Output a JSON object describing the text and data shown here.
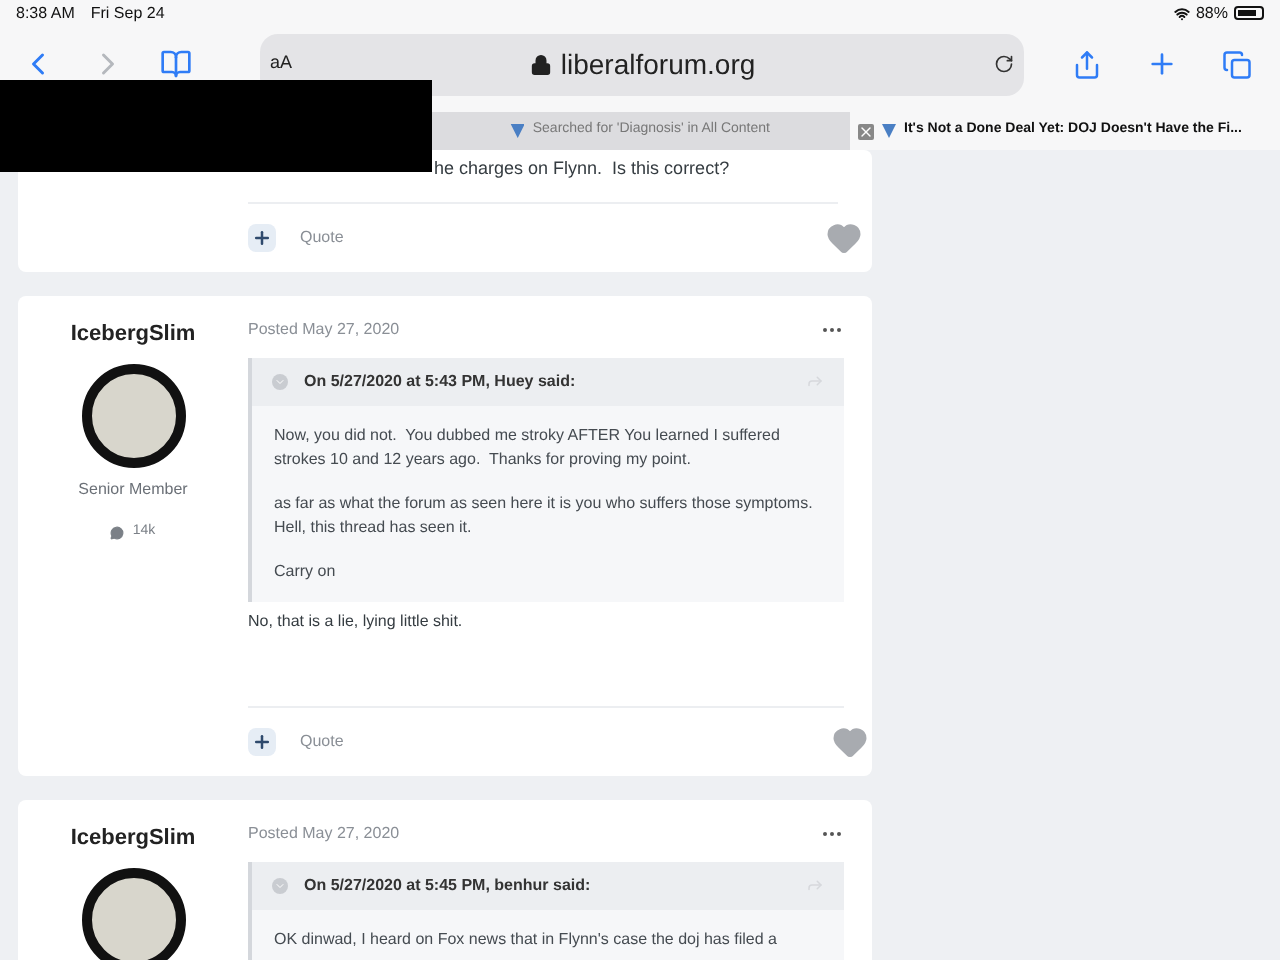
{
  "status_bar": {
    "time": "8:38 AM",
    "date": "Fri Sep 24",
    "battery": "88%"
  },
  "toolbar": {
    "text_size": "aA",
    "address": "liberalforum.org"
  },
  "tabs": [
    {
      "title": "Searched for 'Diagnosis' in All Content",
      "selected": false
    },
    {
      "title": "It's Not a Done Deal Yet: DOJ Doesn't Have the Fi...",
      "selected": true
    }
  ],
  "posts": [
    {
      "kind": "tail",
      "text": "he charges on Flynn.  Is this correct?",
      "quote_action": "Quote"
    },
    {
      "kind": "full",
      "author": "IcebergSlim",
      "role": "Senior Member",
      "post_count": "14k",
      "posted": "Posted May 27, 2020",
      "quote": {
        "header": "On 5/27/2020 at 5:43 PM, Huey said:",
        "paragraphs": [
          "Now, you did not.  You dubbed me stroky AFTER You learned I suffered strokes 10 and 12 years ago.  Thanks for proving my point.",
          "as far as what the forum as seen here it is you who suffers those symptoms.  Hell, this thread has seen it.",
          "Carry on"
        ]
      },
      "body": "No, that is a lie, lying little shit.",
      "quote_action": "Quote"
    },
    {
      "kind": "full",
      "author": "IcebergSlim",
      "posted": "Posted May 27, 2020",
      "quote": {
        "header": "On 5/27/2020 at 5:45 PM, benhur said:",
        "paragraphs": [
          "OK dinwad, I heard on Fox news that in Flynn's case the doj has filed a"
        ]
      }
    }
  ]
}
